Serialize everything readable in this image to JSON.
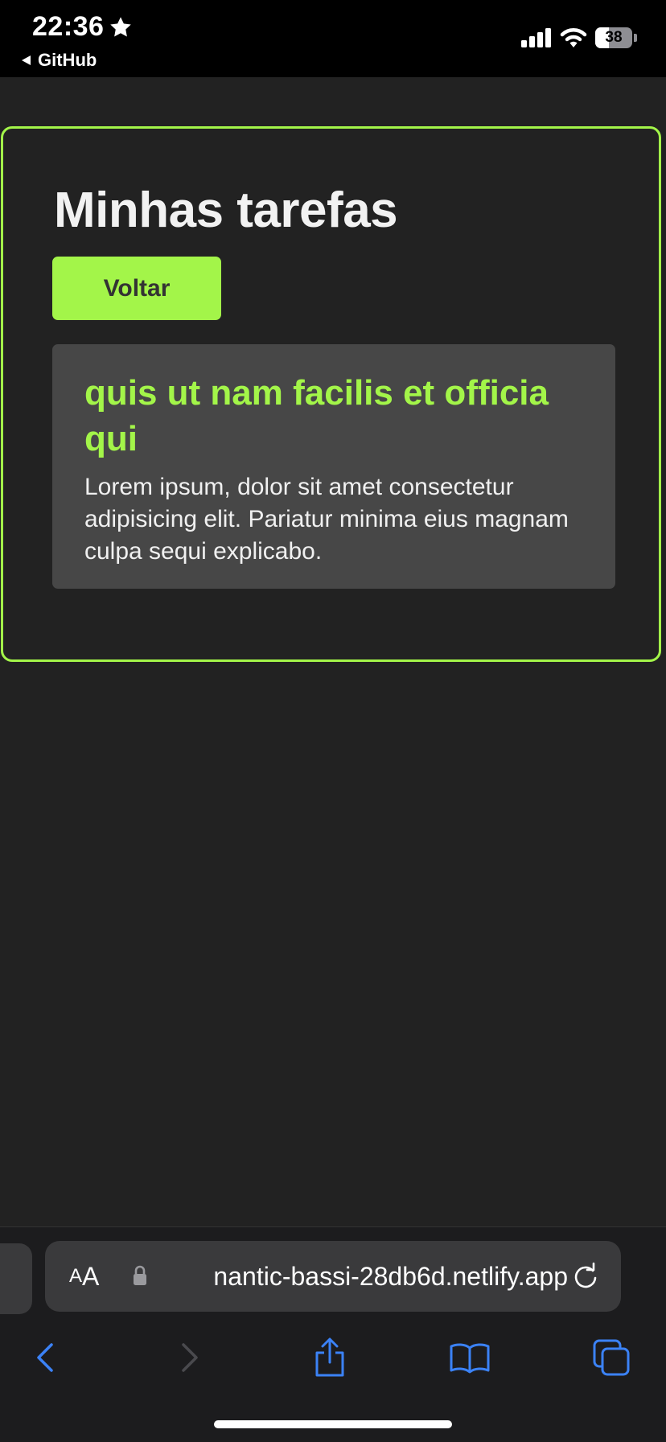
{
  "status_bar": {
    "time": "22:36",
    "back_app": "GitHub",
    "battery": "38",
    "battery_level": 0.38,
    "icons": [
      "star-icon",
      "cellular-signal-icon",
      "wifi-icon",
      "battery-icon"
    ]
  },
  "page": {
    "title": "Minhas tarefas",
    "back_button": "Voltar",
    "task": {
      "title": "quis ut nam facilis et officia qui",
      "description": "Lorem ipsum, dolor sit amet consectetur adipisicing elit. Pariatur minima eius magnam culpa sequi explicabo."
    }
  },
  "browser": {
    "text_size_small": "A",
    "text_size_big": "A",
    "url": "nantic-bassi-28db6d.netlify.app",
    "toolbar": [
      "back-icon",
      "forward-icon",
      "share-icon",
      "bookmarks-icon",
      "tabs-icon"
    ]
  },
  "colors": {
    "accent": "#a3f549",
    "background": "#222222",
    "card": "#474747",
    "ios_blue": "#3b82f6"
  }
}
